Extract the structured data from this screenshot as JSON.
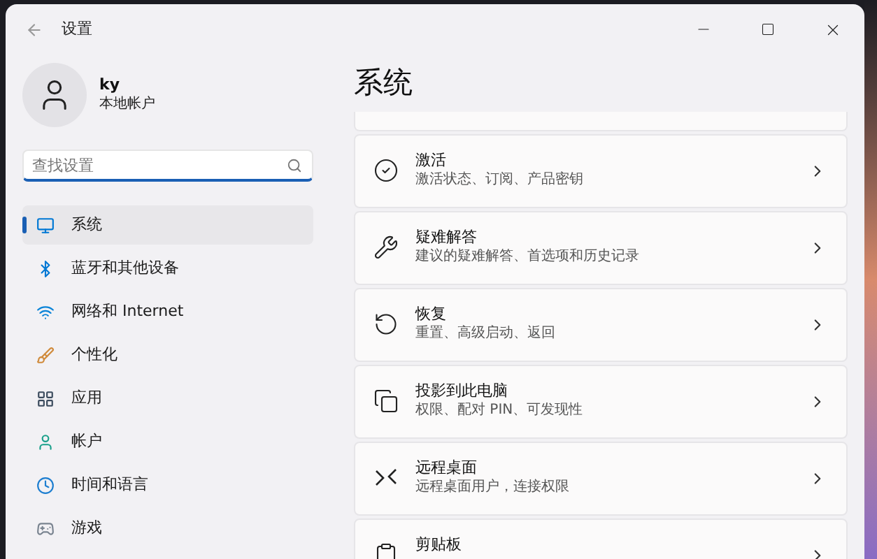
{
  "window": {
    "title": "设置"
  },
  "profile": {
    "name": "ky",
    "account_type": "本地帐户"
  },
  "search": {
    "placeholder": "查找设置"
  },
  "sidebar": {
    "items": [
      {
        "kind": "system",
        "label": "系统",
        "selected": true
      },
      {
        "kind": "bluetooth",
        "label": "蓝牙和其他设备",
        "selected": false
      },
      {
        "kind": "network",
        "label": "网络和 Internet",
        "selected": false
      },
      {
        "kind": "personalize",
        "label": "个性化",
        "selected": false
      },
      {
        "kind": "apps",
        "label": "应用",
        "selected": false
      },
      {
        "kind": "accounts",
        "label": "帐户",
        "selected": false
      },
      {
        "kind": "time",
        "label": "时间和语言",
        "selected": false
      },
      {
        "kind": "gaming",
        "label": "游戏",
        "selected": false
      }
    ]
  },
  "main": {
    "title": "系统",
    "cards": [
      {
        "kind": "activation",
        "title": "激活",
        "subtitle": "激活状态、订阅、产品密钥"
      },
      {
        "kind": "troubleshoot",
        "title": "疑难解答",
        "subtitle": "建议的疑难解答、首选项和历史记录"
      },
      {
        "kind": "recovery",
        "title": "恢复",
        "subtitle": "重置、高级启动、返回"
      },
      {
        "kind": "projection",
        "title": "投影到此电脑",
        "subtitle": "权限、配对 PIN、可发现性"
      },
      {
        "kind": "remote",
        "title": "远程桌面",
        "subtitle": "远程桌面用户，连接权限"
      },
      {
        "kind": "clipboard",
        "title": "剪贴板"
      }
    ]
  }
}
